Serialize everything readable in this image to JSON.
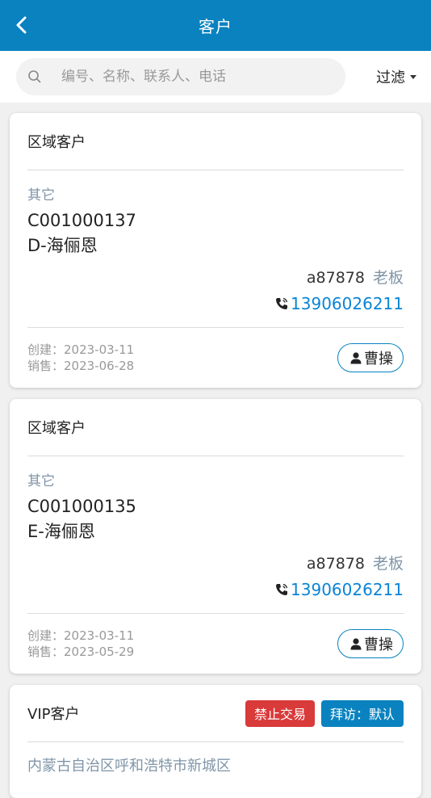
{
  "header": {
    "title": "客户"
  },
  "search": {
    "placeholder": "编号、名称、联系人、电话",
    "filter_label": "过滤"
  },
  "customers": [
    {
      "type": "区域客户",
      "category": "其它",
      "code": "C001000137",
      "name": "D-海俪恩",
      "contact_name": "a87878",
      "contact_role": "老板",
      "phone": "13906026211",
      "created": "创建：2023-03-11",
      "sales": "销售：2023-06-28",
      "owner": "曹操"
    },
    {
      "type": "区域客户",
      "category": "其它",
      "code": "C001000135",
      "name": "E-海俪恩",
      "contact_name": "a87878",
      "contact_role": "老板",
      "phone": "13906026211",
      "created": "创建：2023-03-11",
      "sales": "销售：2023-05-29",
      "owner": "曹操"
    },
    {
      "type": "VIP客户",
      "badge_banned": "禁止交易",
      "badge_visit": "拜访：默认",
      "address": "内蒙古自治区呼和浩特市新城区"
    }
  ],
  "colors": {
    "primary": "#0a82c0",
    "danger": "#d93a3a",
    "link": "#0a84d6",
    "muted": "#7f95a8"
  },
  "icons": {
    "back": "chevron-left-icon",
    "search": "search-icon",
    "phone": "phone-icon",
    "user": "user-icon",
    "caret": "caret-down-icon"
  }
}
